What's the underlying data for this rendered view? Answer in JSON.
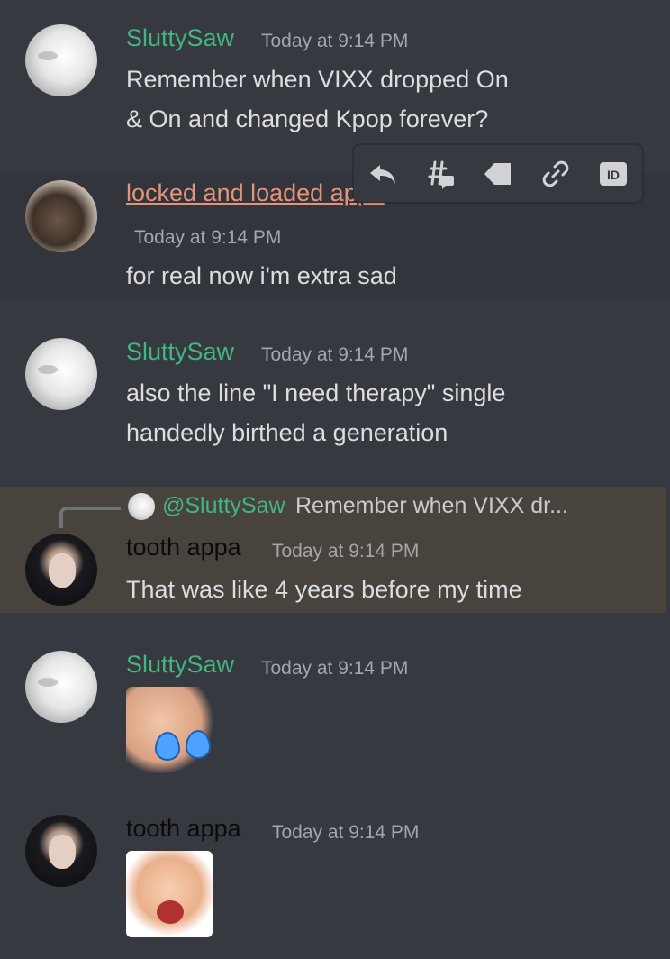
{
  "messages": [
    {
      "user": "SluttySaw",
      "time": "Today at 9:14 PM",
      "lines": [
        "Remember when VIXX dropped On",
        "& On and changed Kpop forever?"
      ]
    },
    {
      "user": "locked and loaded appa",
      "time": "Today at 9:14 PM",
      "lines": [
        "for real now i'm extra sad"
      ]
    },
    {
      "user": "SluttySaw",
      "time": "Today at 9:14 PM",
      "lines": [
        "also the line \"I need therapy\" single",
        "handedly birthed a generation"
      ]
    },
    {
      "user": "tooth appa",
      "time": "Today at 9:14 PM",
      "lines": [
        "That was like 4 years before my time"
      ],
      "reply": {
        "mention": "@SluttySaw",
        "text": "Remember when VIXX dr..."
      }
    },
    {
      "user": "SluttySaw",
      "time": "Today at 9:14 PM",
      "sticker": "crying-face-sticker"
    },
    {
      "user": "tooth appa",
      "time": "Today at 9:14 PM",
      "sticker": "laughing-face-sticker"
    }
  ],
  "toolbar": {
    "icons": [
      "reply-icon",
      "create-thread-icon",
      "tag-icon",
      "copy-link-icon",
      "copy-id-icon"
    ],
    "id_label": "ID"
  },
  "colors": {
    "background": "#36393f",
    "username_green": "#43b581",
    "username_salmon": "#e8927c",
    "username_dark": "#0b0b0b",
    "reply_highlight": "#48433d"
  }
}
